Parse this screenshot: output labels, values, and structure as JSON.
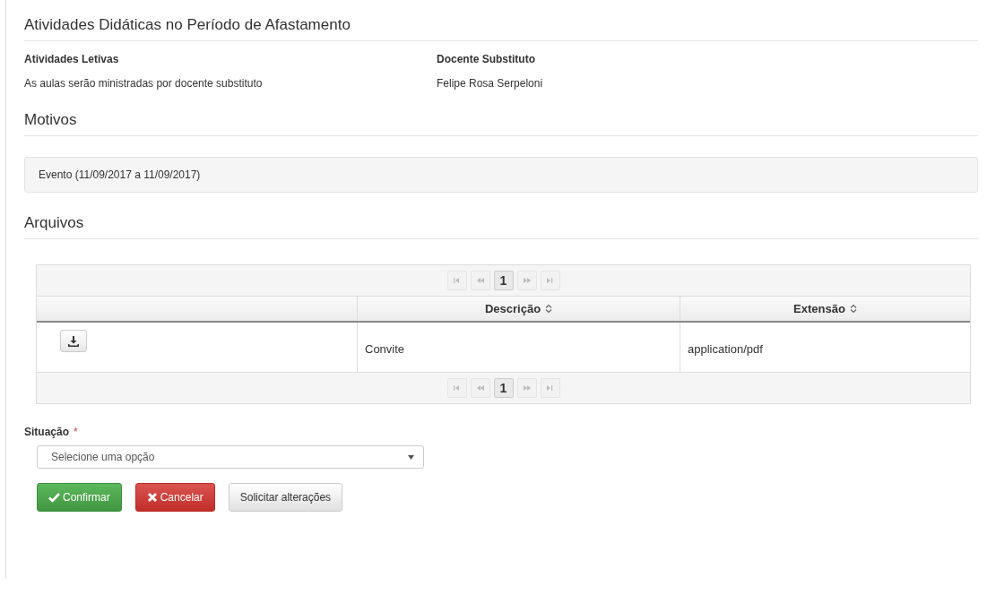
{
  "sections": [
    {
      "title": "Atividades Didáticas no Período de Afastamento",
      "fields": [
        {
          "label": "Atividades Letivas",
          "value": "As aulas serão ministradas por docente substituto"
        },
        {
          "label": "Docente Substituto",
          "value": "Felipe Rosa Serpeloni"
        }
      ]
    },
    {
      "title": "Motivos",
      "well": "Evento (11/09/2017 a 11/09/2017)"
    },
    {
      "title": "Arquivos",
      "table": {
        "top_pager": {
          "pages": [
            {
              "label": "1",
              "selected": true
            }
          ]
        },
        "bottom_pager": {
          "pages": [
            {
              "label": "1",
              "selected": true
            }
          ]
        },
        "columns": [
          "",
          "Descrição",
          "Extensão"
        ],
        "rows": [
          [
            "Convite",
            "application/pdf"
          ]
        ]
      }
    }
  ],
  "form": {
    "label": "Situação",
    "required": "*",
    "select": {
      "placeholder": "Selecione uma opção"
    },
    "buttons": [
      {
        "kind": "confirm",
        "label": "Confirmar"
      },
      {
        "kind": "cancel",
        "label": "Cancelar"
      },
      {
        "kind": "default",
        "label": "Solicitar alterações"
      }
    ]
  }
}
